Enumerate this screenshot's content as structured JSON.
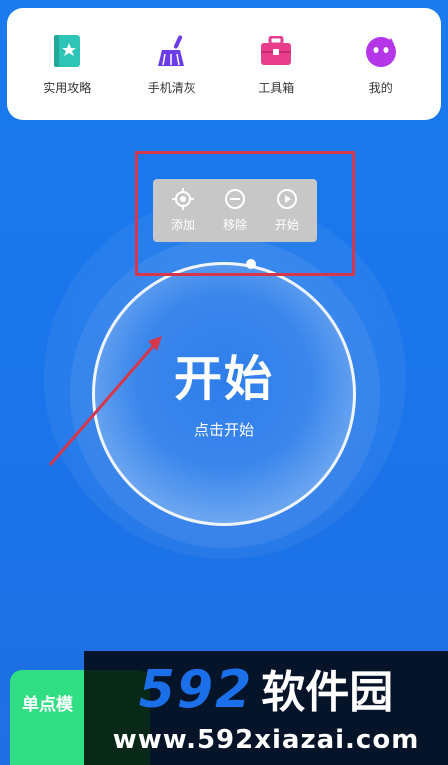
{
  "nav": {
    "items": [
      {
        "label": "实用攻略",
        "icon": "book-star-icon",
        "color": "#2EC4B6"
      },
      {
        "label": "手机清灰",
        "icon": "broom-icon",
        "color": "#6A3DE8"
      },
      {
        "label": "工具箱",
        "icon": "toolbox-icon",
        "color": "#E83E8C"
      },
      {
        "label": "我的",
        "icon": "face-icon",
        "color": "#B535E8"
      }
    ]
  },
  "controls": {
    "add_label": "添加",
    "remove_label": "移除",
    "start_label": "开始"
  },
  "main": {
    "start_title": "开始",
    "start_subtitle": "点击开始"
  },
  "bottom": {
    "mode_label": "单点模"
  },
  "watermark": {
    "brand_number": "592",
    "brand_name": "软件园",
    "url": "www.592xiazai.com"
  },
  "colors": {
    "background": "#1A7AEE",
    "highlight": "#D6364A",
    "mode_button": "#30DE83"
  }
}
